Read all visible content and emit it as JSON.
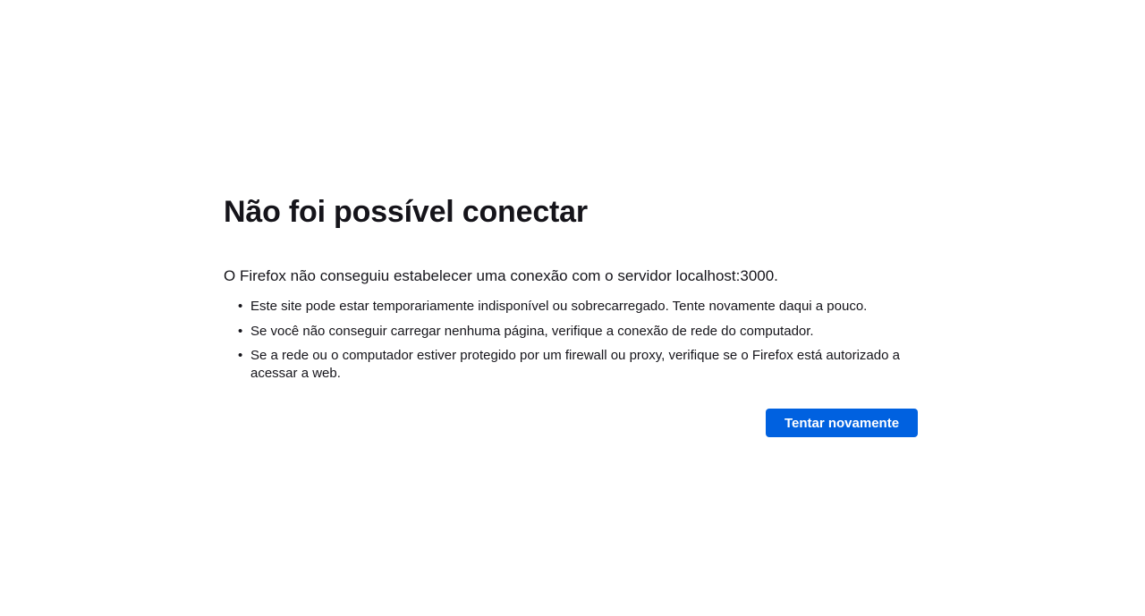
{
  "error": {
    "title": "Não foi possível conectar",
    "intro": "O Firefox não conseguiu estabelecer uma conexão com o servidor localhost:3000.",
    "suggestions": [
      "Este site pode estar temporariamente indisponível ou sobrecarregado. Tente novamente daqui a pouco.",
      "Se você não conseguir carregar nenhuma página, verifique a conexão de rede do computador.",
      "Se a rede ou o computador estiver protegido por um firewall ou proxy, verifique se o Firefox está autorizado a acessar a web."
    ],
    "retry_label": "Tentar novamente"
  },
  "colors": {
    "accent": "#0061e0",
    "text": "#15141a",
    "background": "#ffffff"
  }
}
